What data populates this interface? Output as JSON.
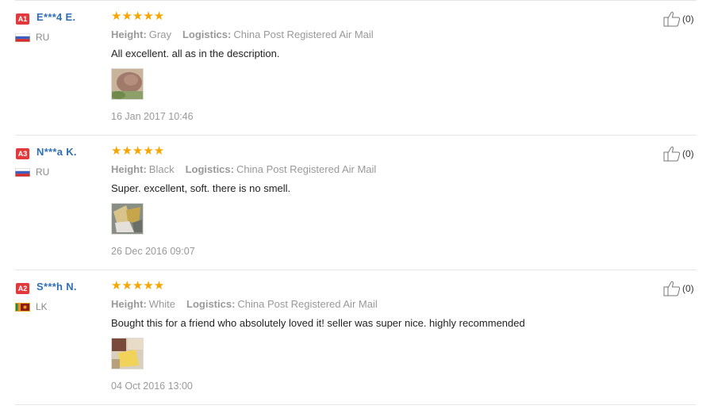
{
  "reviews": [
    {
      "badge": "A1",
      "username": "E***4 E.",
      "country": "RU",
      "stars": "★★★★★",
      "height_label": "Height:",
      "height_value": "Gray",
      "logistics_label": "Logistics:",
      "logistics_value": "China Post Registered Air Mail",
      "text": "All excellent. all as in the description.",
      "date": "16 Jan 2017 10:46",
      "likes": "(0)"
    },
    {
      "badge": "A3",
      "username": "N***a K.",
      "country": "RU",
      "stars": "★★★★★",
      "height_label": "Height:",
      "height_value": "Black",
      "logistics_label": "Logistics:",
      "logistics_value": "China Post Registered Air Mail",
      "text": "Super. excellent, soft. there is no smell.",
      "date": "26 Dec 2016 09:07",
      "likes": "(0)"
    },
    {
      "badge": "A2",
      "username": "S***h N.",
      "country": "LK",
      "stars": "★★★★★",
      "height_label": "Height:",
      "height_value": "White",
      "logistics_label": "Logistics:",
      "logistics_value": "China Post Registered Air Mail",
      "text": "Bought this for a friend who absolutely loved it! seller was super nice. highly recommended",
      "date": "04 Oct 2016 13:00",
      "likes": "(0)"
    }
  ],
  "colors": {
    "badge": "#e4393c",
    "username": "#2f6fb5",
    "stars": "#f7a500"
  },
  "icons": {
    "flag_ru": "russia-flag-icon",
    "flag_lk": "sri-lanka-flag-icon",
    "like": "thumbs-up-icon",
    "stars": "star-rating-icon"
  }
}
